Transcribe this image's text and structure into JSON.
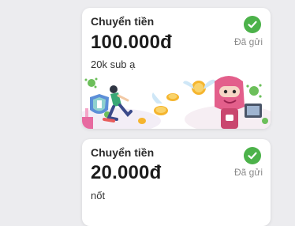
{
  "transfers": [
    {
      "title": "Chuyển tiền",
      "amount": "100.000đ",
      "status": "Đã gửi",
      "message": "20k sub ạ",
      "status_icon": "check-circle-icon",
      "status_color": "#4cb24a",
      "illustration": "money-transfer-illustration"
    },
    {
      "title": "Chuyển tiền",
      "amount": "20.000đ",
      "status": "Đã gửi",
      "message": "nốt",
      "status_icon": "check-circle-icon",
      "status_color": "#4cb24a"
    }
  ]
}
